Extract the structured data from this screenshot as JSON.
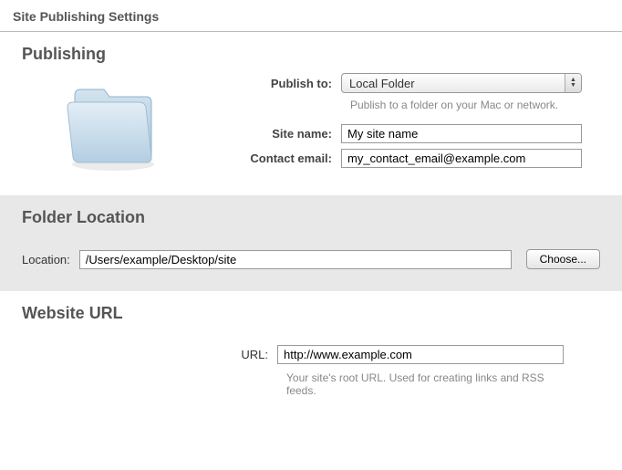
{
  "title": "Site Publishing Settings",
  "publishing": {
    "heading": "Publishing",
    "publish_to_label": "Publish to:",
    "publish_to_value": "Local Folder",
    "publish_hint": "Publish to a folder on your Mac or network.",
    "site_name_label": "Site name:",
    "site_name_value": "My site name",
    "contact_email_label": "Contact email:",
    "contact_email_value": "my_contact_email@example.com"
  },
  "folder_location": {
    "heading": "Folder Location",
    "location_label": "Location:",
    "location_value": "/Users/example/Desktop/site",
    "choose_label": "Choose..."
  },
  "website_url": {
    "heading": "Website URL",
    "url_label": "URL:",
    "url_value": "http://www.example.com",
    "hint": "Your site's root URL. Used for creating links and RSS feeds."
  }
}
